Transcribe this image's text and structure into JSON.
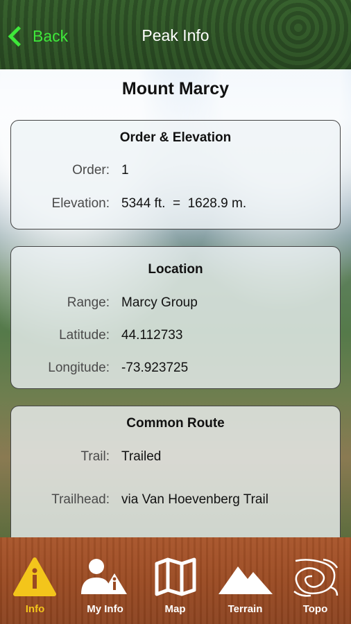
{
  "nav": {
    "back_label": "Back",
    "title": "Peak Info"
  },
  "peak_name": "Mount Marcy",
  "sections": {
    "order_elevation": {
      "title": "Order & Elevation",
      "order_label": "Order:",
      "order_value": "1",
      "elevation_label": "Elevation:",
      "elevation_value": "5344 ft.  =  1628.9 m."
    },
    "location": {
      "title": "Location",
      "range_label": "Range:",
      "range_value": "Marcy Group",
      "latitude_label": "Latitude:",
      "latitude_value": "44.112733",
      "longitude_label": "Longitude:",
      "longitude_value": "-73.923725"
    },
    "common_route": {
      "title": "Common Route",
      "trail_label": "Trail:",
      "trail_value": "Trailed",
      "trailhead_label": "Trailhead:",
      "trailhead_value": "via Van Hoevenberg Trail"
    }
  },
  "tabs": [
    {
      "label": "Info",
      "icon": "info-warning-icon"
    },
    {
      "label": "My Info",
      "icon": "person-info-icon"
    },
    {
      "label": "Map",
      "icon": "folded-map-icon"
    },
    {
      "label": "Terrain",
      "icon": "mountains-icon"
    },
    {
      "label": "Topo",
      "icon": "topo-contour-icon"
    }
  ],
  "colors": {
    "back_green": "#3ee83a",
    "active_tab": "#f3c51b",
    "tabbar_wood": "#9a4a22"
  }
}
